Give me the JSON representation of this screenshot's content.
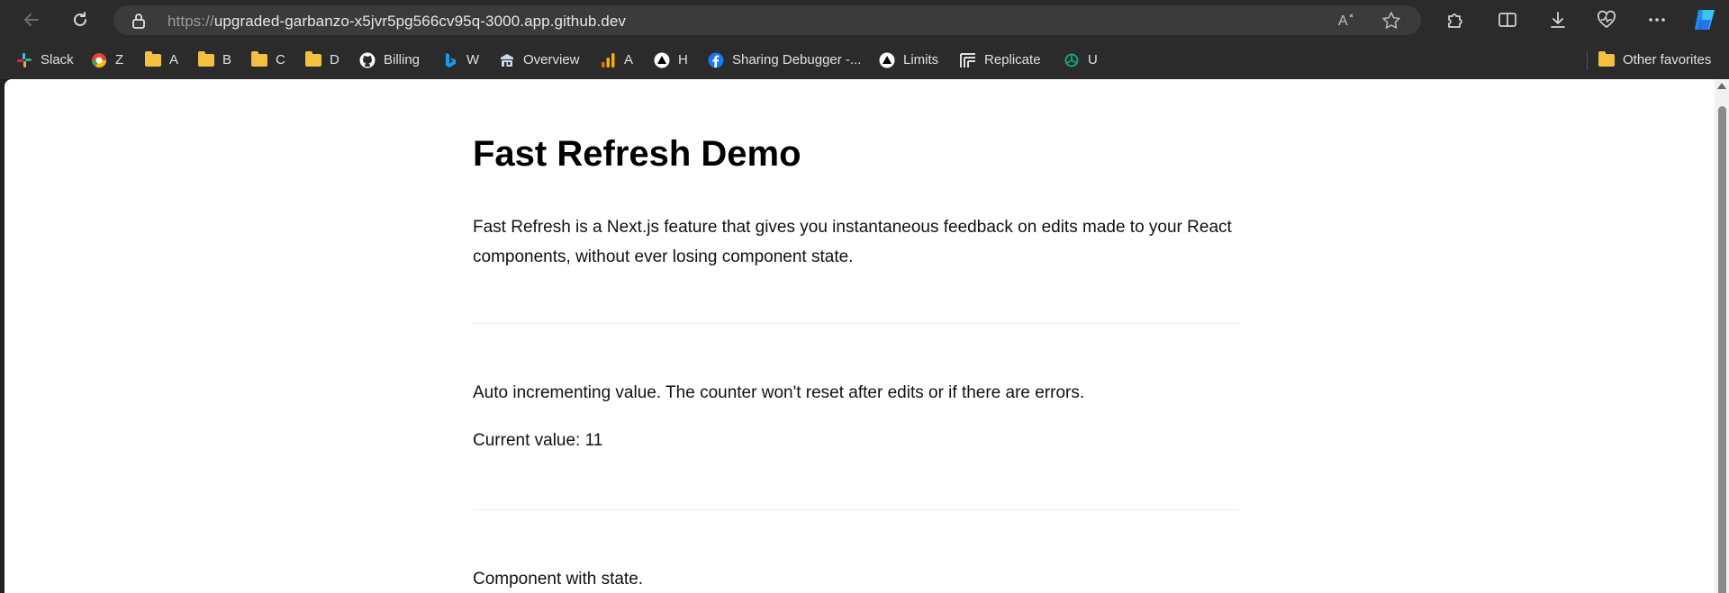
{
  "browser": {
    "url_prefix": "https://",
    "url_host": "upgraded-garbanzo-x5jvr5pg566cv95q-3000.app.github.dev"
  },
  "bookmarks": [
    {
      "label": "Slack",
      "icon": "slack-icon"
    },
    {
      "label": "Z",
      "icon": "chrome-app-icon"
    },
    {
      "label": "A",
      "icon": "folder-icon"
    },
    {
      "label": "B",
      "icon": "folder-icon"
    },
    {
      "label": "C",
      "icon": "folder-icon"
    },
    {
      "label": "D",
      "icon": "folder-icon"
    },
    {
      "label": "Billing",
      "icon": "github-icon"
    },
    {
      "label": "W",
      "icon": "bing-icon"
    },
    {
      "label": "Overview",
      "icon": "app-icon"
    },
    {
      "label": "A",
      "icon": "analytics-icon"
    },
    {
      "label": "H",
      "icon": "triangle-logo-icon"
    },
    {
      "label": "Sharing Debugger -...",
      "icon": "facebook-icon"
    },
    {
      "label": "Limits",
      "icon": "triangle-logo-icon"
    },
    {
      "label": "Replicate",
      "icon": "replicate-icon"
    },
    {
      "label": "U",
      "icon": "openai-icon"
    }
  ],
  "other_favorites": "Other favorites",
  "page": {
    "title": "Fast Refresh Demo",
    "intro": "Fast Refresh is a Next.js feature that gives you instantaneous feedback on edits made to your React components, without ever losing component state.",
    "auto_increment_text": "Auto incrementing value. The counter won't reset after edits or if there are errors.",
    "current_value_label": "Current value: 11",
    "component_state_text": "Component with state."
  }
}
